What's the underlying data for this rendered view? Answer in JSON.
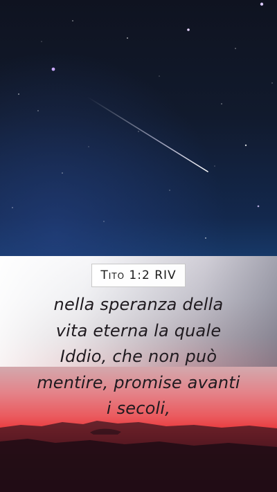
{
  "reference": "Tito 1:2 RIV",
  "verse_lines": [
    "nella speranza della",
    "vita eterna la quale",
    "Iddio, che non può",
    "mentire, promise avanti",
    "i secoli,"
  ],
  "colors": {
    "sky_top": "#0f1320",
    "sky_bottom": "#173867",
    "sunset_red": "#e8383b",
    "text": "#1f1a1f"
  }
}
